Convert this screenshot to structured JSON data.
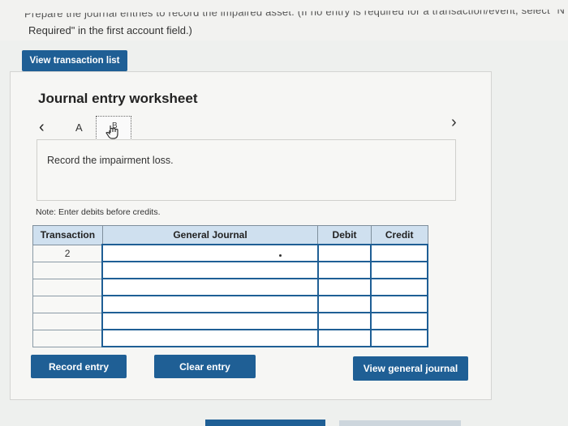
{
  "instructions": {
    "cut_top_line": "Prepare the journal entries to record the impaired asset. (If no entry is required for a transaction/event, select \"No Jo",
    "required_line": "Required\" in the first account field.)"
  },
  "buttons": {
    "view_transaction_list": "View transaction list",
    "record_entry": "Record entry",
    "clear_entry": "Clear entry",
    "view_general_journal": "View general journal"
  },
  "worksheet": {
    "title": "Journal entry worksheet",
    "tabs": [
      "A",
      "B"
    ],
    "prompt": "Record the impairment loss.",
    "note": "Note: Enter debits before credits."
  },
  "table": {
    "headers": [
      "Transaction",
      "General Journal",
      "Debit",
      "Credit"
    ],
    "rows": [
      {
        "transaction": "2",
        "general_journal": "",
        "debit": "",
        "credit": ""
      },
      {
        "transaction": "",
        "general_journal": "",
        "debit": "",
        "credit": ""
      },
      {
        "transaction": "",
        "general_journal": "",
        "debit": "",
        "credit": ""
      },
      {
        "transaction": "",
        "general_journal": "",
        "debit": "",
        "credit": ""
      },
      {
        "transaction": "",
        "general_journal": "",
        "debit": "",
        "credit": ""
      },
      {
        "transaction": "",
        "general_journal": "",
        "debit": "",
        "credit": ""
      }
    ]
  }
}
